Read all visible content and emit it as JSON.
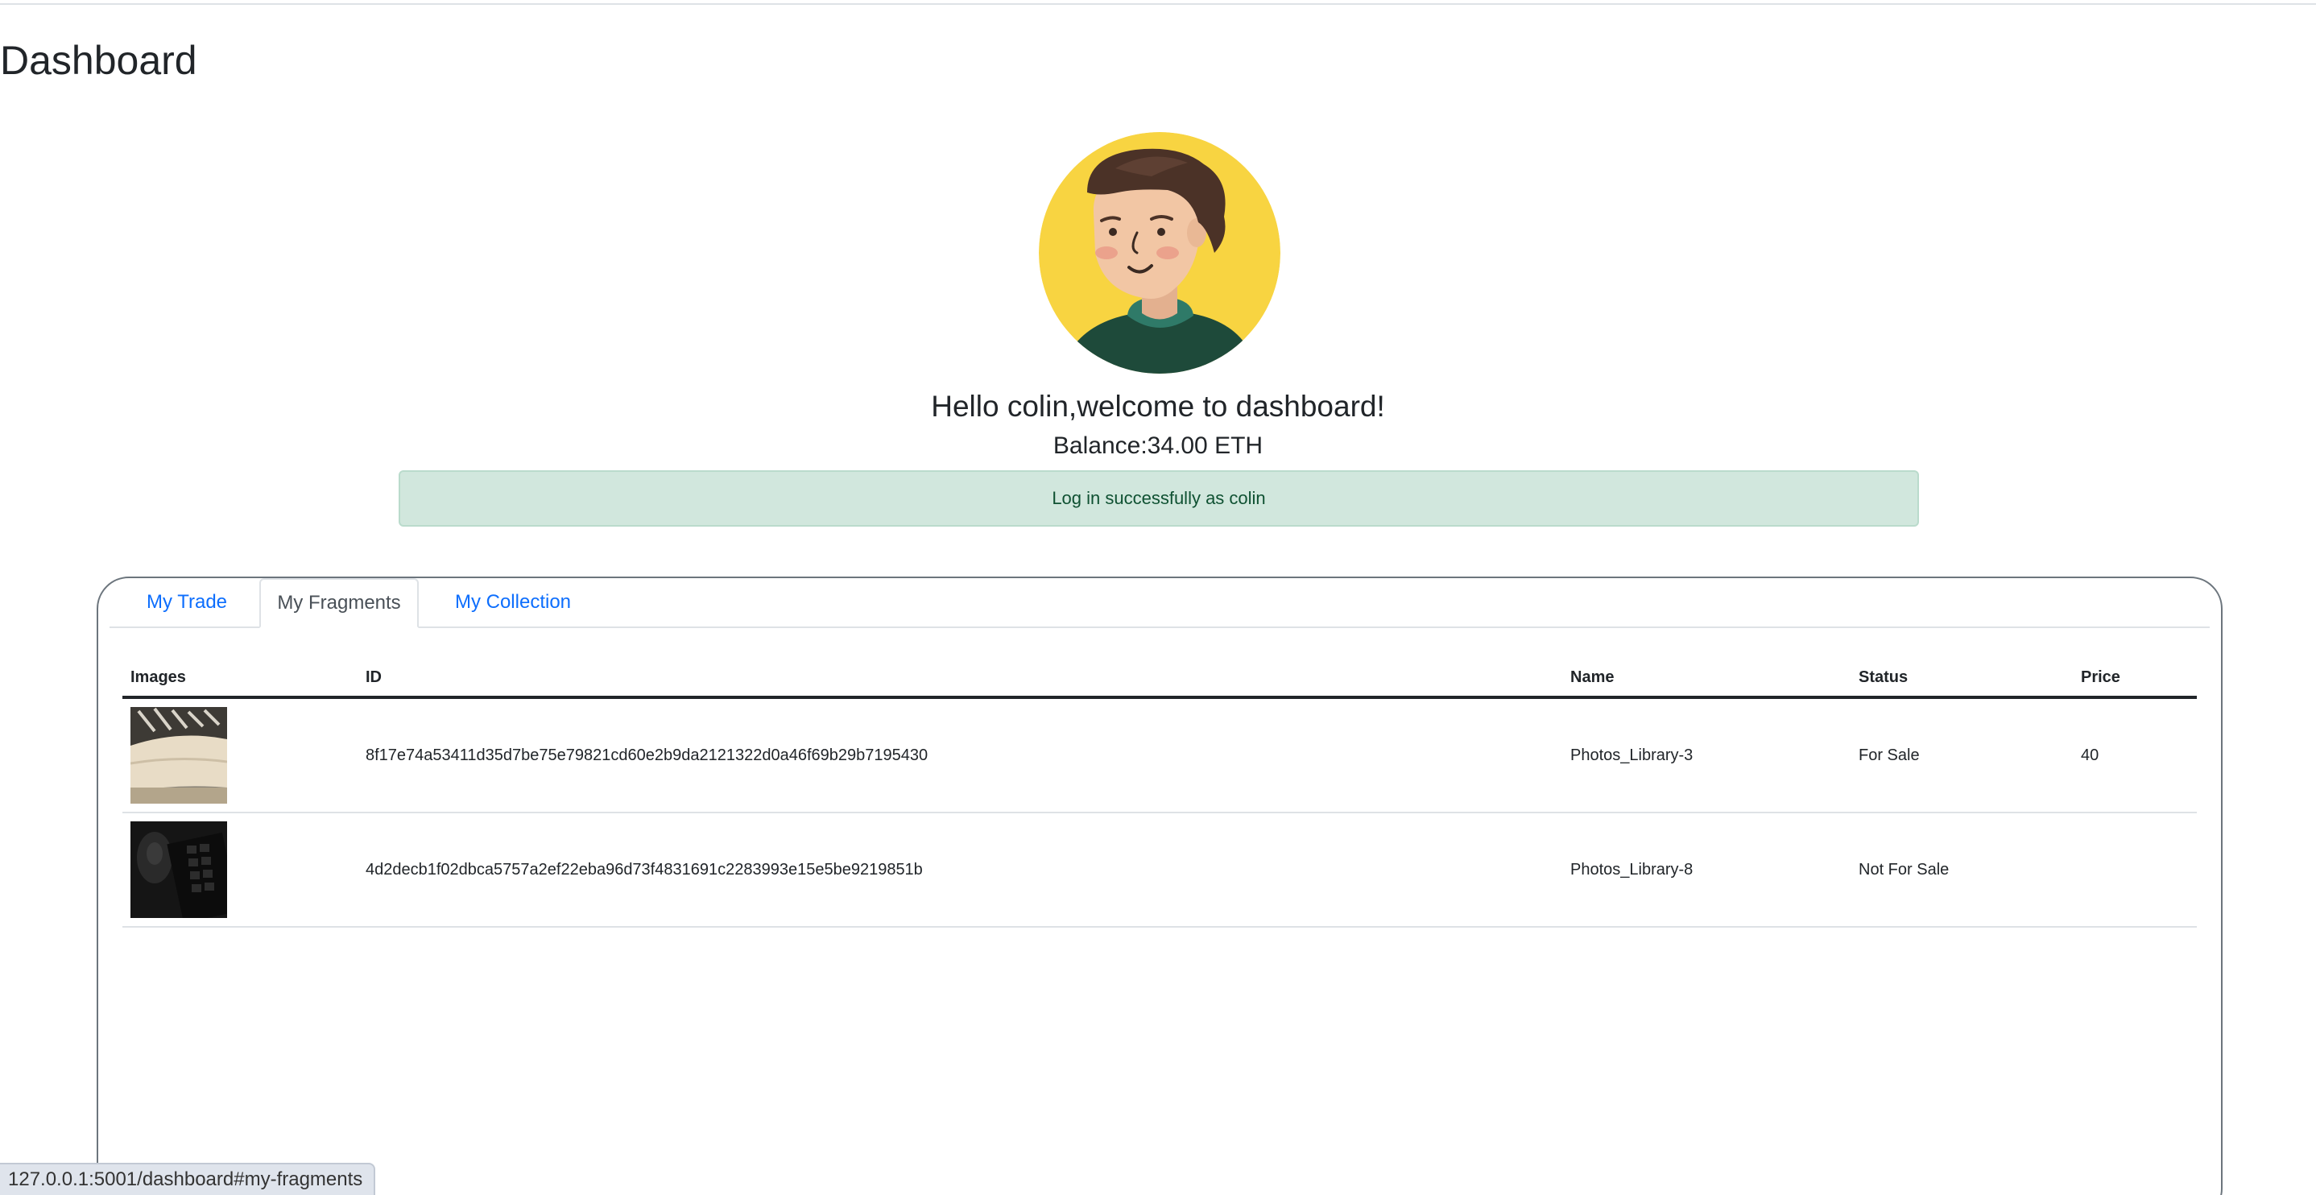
{
  "page": {
    "title": "Dashboard"
  },
  "user": {
    "greeting": "Hello colin,welcome to dashboard!",
    "balance": "Balance:34.00 ETH"
  },
  "flash": {
    "message": "Log in successfully as colin"
  },
  "tabs": [
    {
      "label": "My Trade",
      "active": false
    },
    {
      "label": "My Fragments",
      "active": true
    },
    {
      "label": "My Collection",
      "active": false
    }
  ],
  "table": {
    "headers": [
      "Images",
      "ID",
      "Name",
      "Status",
      "Price"
    ],
    "rows": [
      {
        "id": "8f17e74a53411d35d7be75e79821cd60e2b9da2121322d0a46f69b29b7195430",
        "name": "Photos_Library-3",
        "status": "For Sale",
        "price": "40"
      },
      {
        "id": "4d2decb1f02dbca5757a2ef22eba96d73f4831691c2283993e15e5be9219851b",
        "name": "Photos_Library-8",
        "status": "Not For Sale",
        "price": ""
      }
    ]
  },
  "status_bar": {
    "url": "127.0.0.1:5001/dashboard#my-fragments"
  },
  "colors": {
    "link": "#0d6efd",
    "flash_bg": "#d1e7dd",
    "flash_text": "#0f5132",
    "avatar_bg": "#f8d441"
  }
}
